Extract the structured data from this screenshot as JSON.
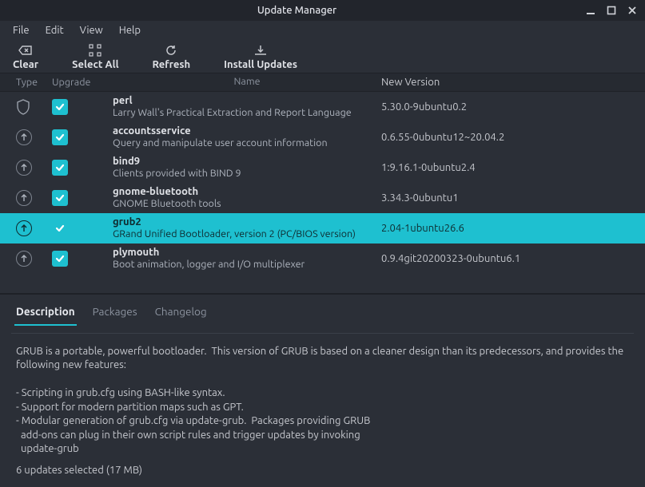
{
  "window": {
    "title": "Update Manager"
  },
  "menubar": {
    "file": "File",
    "edit": "Edit",
    "view": "View",
    "help": "Help"
  },
  "toolbar": {
    "clear": "Clear",
    "select_all": "Select All",
    "refresh": "Refresh",
    "install": "Install Updates"
  },
  "columns": {
    "type": "Type",
    "upgrade": "Upgrade",
    "name": "Name",
    "new_version": "New Version"
  },
  "packages": [
    {
      "type_icon": "shield",
      "checked": true,
      "name": "perl",
      "desc": "Larry Wall's Practical Extraction and Report Language",
      "new_version": "5.30.0-9ubuntu0.2",
      "selected": false
    },
    {
      "type_icon": "up",
      "checked": true,
      "name": "accountsservice",
      "desc": "Query and manipulate user account information",
      "new_version": "0.6.55-0ubuntu12~20.04.2",
      "selected": false
    },
    {
      "type_icon": "up",
      "checked": true,
      "name": "bind9",
      "desc": "Clients provided with BIND 9",
      "new_version": "1:9.16.1-0ubuntu2.4",
      "selected": false
    },
    {
      "type_icon": "up",
      "checked": true,
      "name": "gnome-bluetooth",
      "desc": "GNOME Bluetooth tools",
      "new_version": "3.34.3-0ubuntu1",
      "selected": false
    },
    {
      "type_icon": "up",
      "checked": true,
      "name": "grub2",
      "desc": "GRand Unified Bootloader, version 2 (PC/BIOS version)",
      "new_version": "2.04-1ubuntu26.6",
      "selected": true
    },
    {
      "type_icon": "up",
      "checked": true,
      "name": "plymouth",
      "desc": "Boot animation, logger and I/O multiplexer",
      "new_version": "0.9.4git20200323-0ubuntu6.1",
      "selected": false
    }
  ],
  "tabs": {
    "description": "Description",
    "packages": "Packages",
    "changelog": "Changelog"
  },
  "description_text": "GRUB is a portable, powerful bootloader.  This version of GRUB is based on a cleaner design than its predecessors, and provides the following new features:\n\n- Scripting in grub.cfg using BASH-like syntax.\n- Support for modern partition maps such as GPT.\n- Modular generation of grub.cfg via update-grub.  Packages providing GRUB\n  add-ons can plug in their own script rules and trigger updates by invoking\n  update-grub",
  "status": "6 updates selected (17 MB)"
}
